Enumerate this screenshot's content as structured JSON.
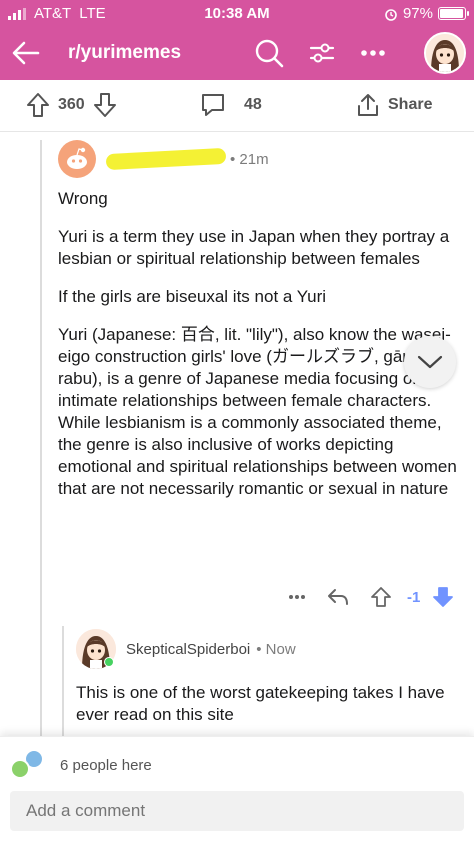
{
  "status_bar": {
    "carrier": "AT&T",
    "network": "LTE",
    "time": "10:38 AM",
    "battery": "97%",
    "battery_level": 0.97
  },
  "header": {
    "title": "r/yurimemes",
    "icons": [
      "back-arrow-icon",
      "search-icon",
      "filter-icon",
      "more-icon",
      "profile-avatar"
    ],
    "color": "#d6549f"
  },
  "post_actions": {
    "score": "360",
    "comments": "48",
    "share_label": "Share"
  },
  "comment": {
    "age": "• 21m",
    "paragraphs": [
      "Wrong",
      "Yuri is a term they use in Japan when they portray a lesbian or spiritual relationship between females",
      "If the girls are biseuxal its not a Yuri",
      "Yuri (Japanese: 百合, lit. \"lily\"), also know the wasei-eigo construction girls' love (ガールズラブ, gāruzu rabu), is a genre of Japanese media focusing on intimate relationships between female characters. While lesbianism is a commonly associated theme, the genre is also inclusive of works depicting emotional and spiritual relationships between women that are not necessarily romantic or sexual in nature"
    ],
    "score": "-1"
  },
  "reply": {
    "username": "SkepticalSpiderboi",
    "age": "• Now",
    "body": "This is one of the worst gatekeeping takes I have ever read on this site"
  },
  "footer": {
    "people_here": "6 people here",
    "add_comment_placeholder": "Add a comment"
  },
  "colors": {
    "accent": "#d6549f",
    "downvote": "#7193ff",
    "online": "#46d160"
  }
}
